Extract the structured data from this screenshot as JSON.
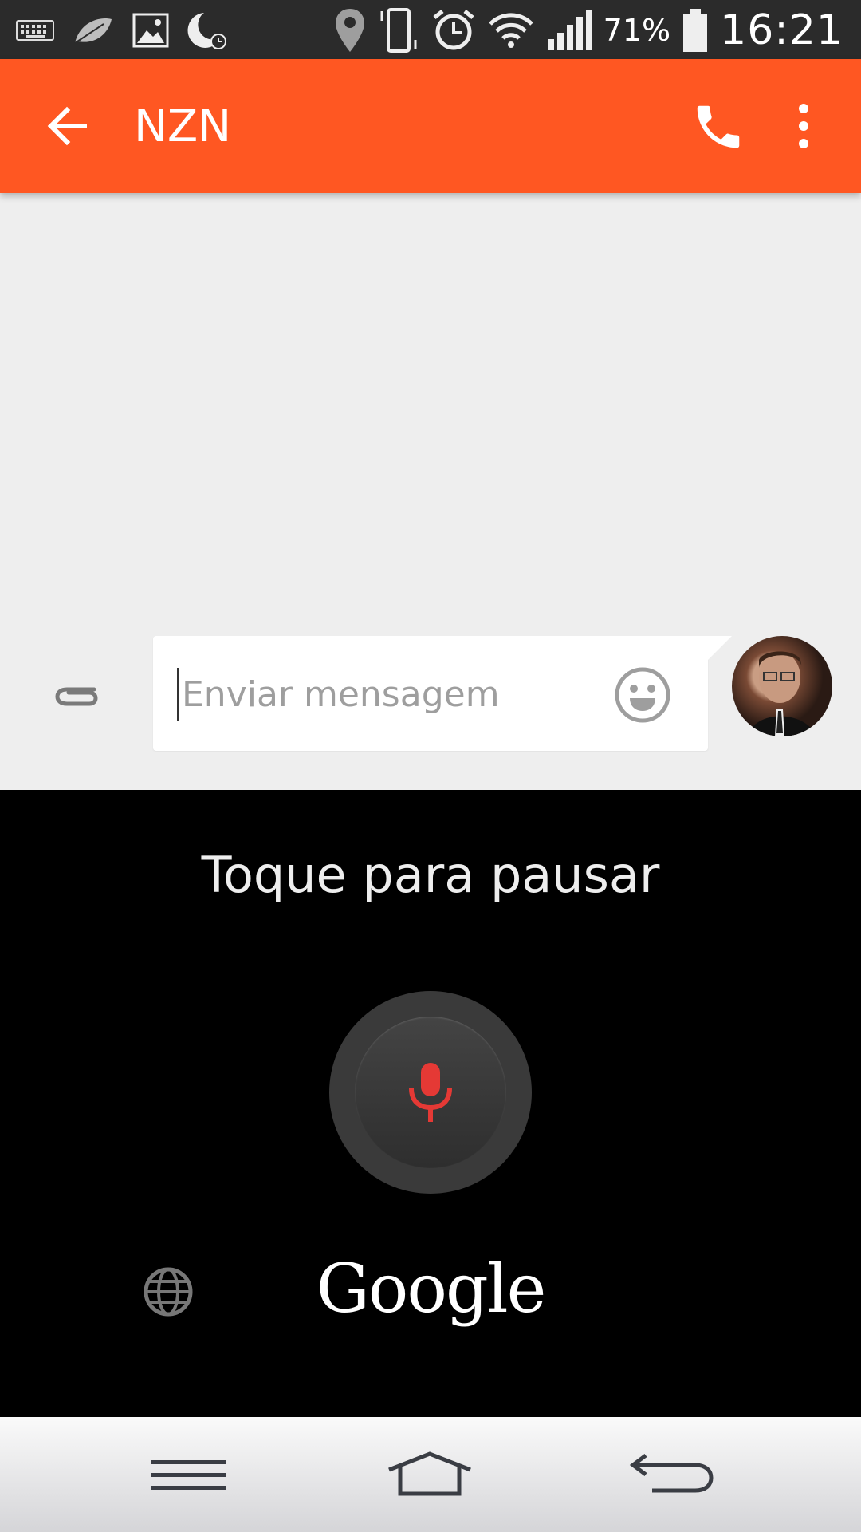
{
  "status_bar": {
    "left_icons": [
      "keyboard-icon",
      "leaf-icon",
      "image-icon",
      "moon-clock-icon"
    ],
    "right_icons": [
      "location-icon",
      "vibrate-icon",
      "alarm-icon",
      "wifi-icon",
      "signal-icon",
      "battery-icon"
    ],
    "battery_percent": "71%",
    "time": "16:21"
  },
  "app_bar": {
    "title": "NZN",
    "back_icon": "arrow-back-icon",
    "call_icon": "phone-icon",
    "more_icon": "more-vert-icon",
    "color": "#ff5722"
  },
  "composer": {
    "placeholder": "Enviar mensagem",
    "value": "",
    "attach_icon": "paperclip-icon",
    "emoji_icon": "smiley-icon"
  },
  "voice_input": {
    "hint": "Toque para pausar",
    "mic_icon": "microphone-icon",
    "mic_color": "#e53935",
    "language_icon": "globe-icon",
    "brand": "Google"
  },
  "nav_bar": {
    "buttons": [
      "menu-icon",
      "home-icon",
      "back-icon"
    ]
  }
}
